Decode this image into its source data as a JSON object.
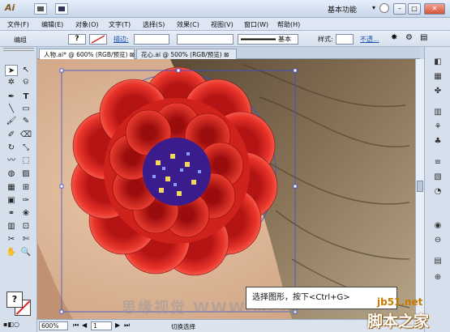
{
  "app": {
    "logo": "Ai",
    "workspace": "基本功能",
    "minimize": "–",
    "maximize": "□",
    "close": "✕"
  },
  "menu": [
    "文件(F)",
    "编辑(E)",
    "对象(O)",
    "文字(T)",
    "选择(S)",
    "效果(C)",
    "视图(V)",
    "窗口(W)",
    "帮助(H)"
  ],
  "options": {
    "group_label": "编组",
    "fill": "?",
    "stroke_label": "描边:",
    "stroke_style": "基本",
    "style_label": "样式:",
    "opacity_label": "不透..."
  },
  "tabs": [
    {
      "label": "人物.ai* @ 600% (RGB/预览)",
      "close": "⊠"
    },
    {
      "label": "花心.ai @ 500% (RGB/预览)",
      "close": "⊠"
    }
  ],
  "status": {
    "zoom": "600%",
    "page": "1",
    "mode": "切换选择"
  },
  "tooltip": "选择图形，按下<Ctrl+G>",
  "watermark": {
    "left": "思缘视觉 WWW.MISSYUAN.COM",
    "site": "jb51.net",
    "name": "脚本之家"
  },
  "colors": {
    "accent": "#e3322a",
    "hair": "#6b5a42",
    "center": "#3b1c8c"
  },
  "tools": [
    "selection",
    "direct-selection",
    "magic-wand",
    "lasso",
    "pen",
    "type",
    "line",
    "rectangle",
    "paintbrush",
    "pencil",
    "rotate",
    "scale",
    "warp",
    "free-transform",
    "symbol-sprayer",
    "column-graph",
    "mesh",
    "gradient",
    "eyedropper",
    "blend",
    "live-paint",
    "live-paint-select",
    "slice",
    "eraser",
    "hand",
    "zoom"
  ],
  "panel_icons": [
    "color",
    "swatches",
    "brushes",
    "symbols",
    "graphic-styles",
    "appearance",
    "layers",
    "transparency",
    "stroke",
    "align",
    "pathfinder",
    "transform"
  ]
}
